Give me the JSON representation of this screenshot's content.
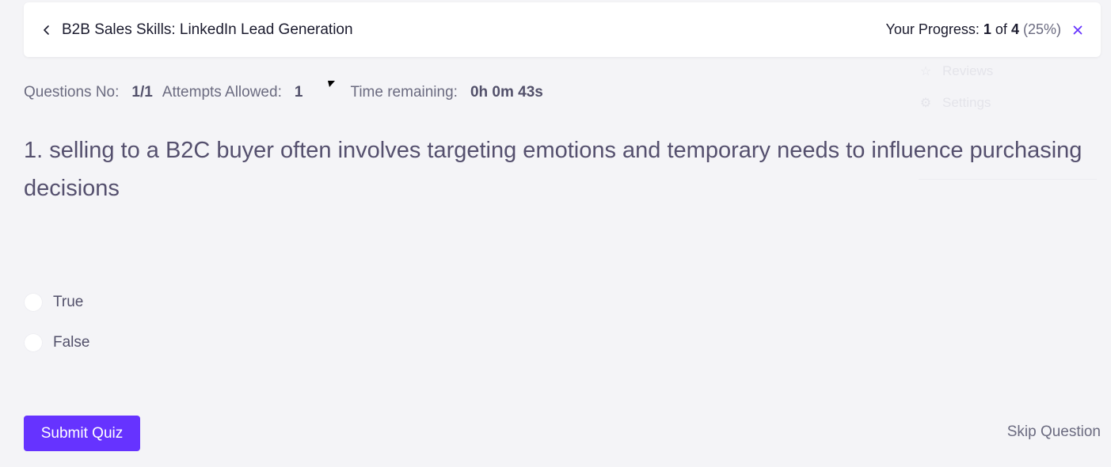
{
  "header": {
    "course_title": "B2B Sales Skills: LinkedIn Lead Generation",
    "progress_label": "Your Progress:",
    "progress_current": "1",
    "progress_of": "of",
    "progress_total": "4",
    "progress_percent": "(25%)",
    "progress_fraction": 0.25
  },
  "ghost_menu": {
    "items": [
      {
        "label": "Reviews",
        "icon": "star-icon"
      },
      {
        "label": "Settings",
        "icon": "gear-icon"
      }
    ]
  },
  "quiz_meta": {
    "questions_label": "Questions No:",
    "questions_value": "1/1",
    "attempts_label": "Attempts Allowed:",
    "attempts_value": "1",
    "time_label": "Time remaining:",
    "time_value": "0h 0m 43s"
  },
  "question": {
    "text": "1. selling to a B2C buyer often involves targeting emotions and temporary needs to influence purchasing decisions",
    "options": [
      {
        "label": "True",
        "selected": false
      },
      {
        "label": "False",
        "selected": false
      }
    ]
  },
  "actions": {
    "submit_label": "Submit Quiz",
    "skip_label": "Skip Question"
  },
  "colors": {
    "accent": "#6633ff",
    "close_icon": "#6633ff",
    "text_dark": "#1b1b2e",
    "text_muted": "#6b6b80"
  }
}
